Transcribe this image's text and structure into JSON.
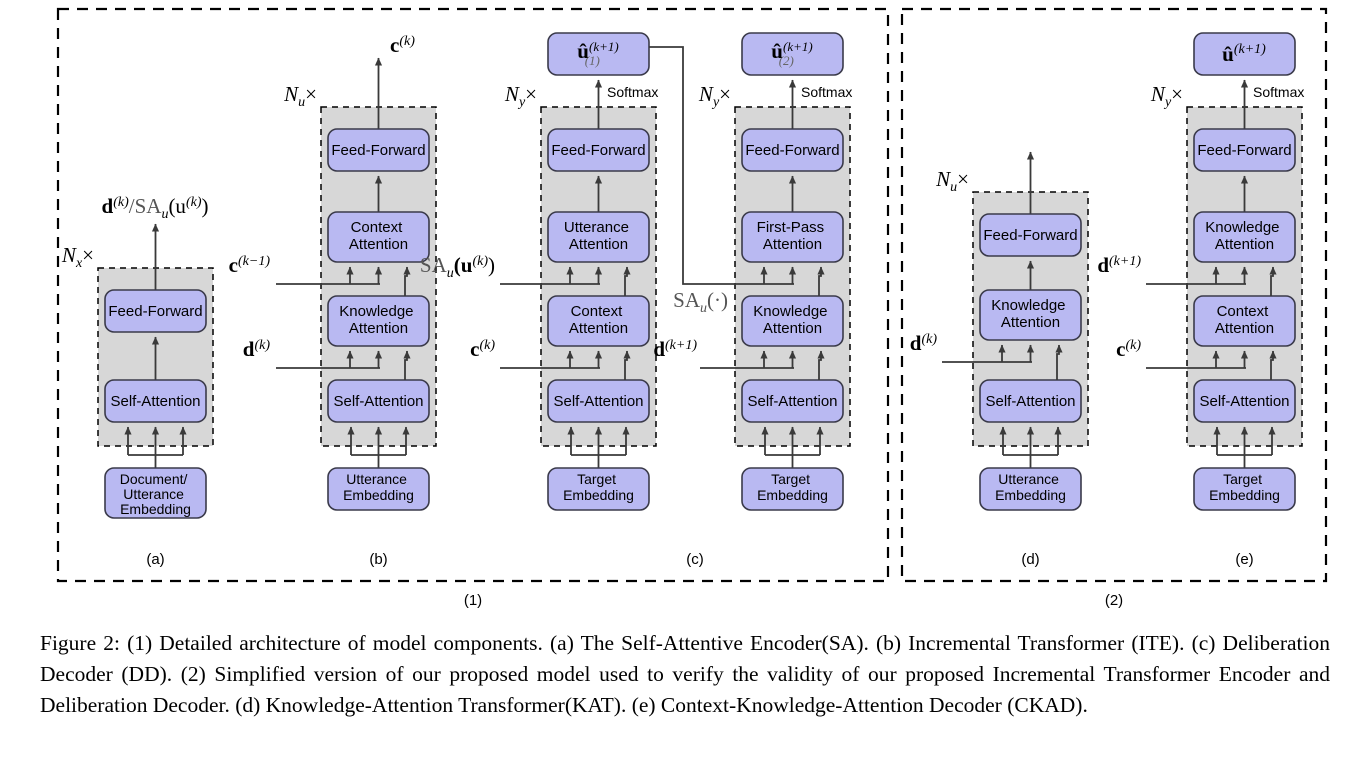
{
  "figure": {
    "caption": "Figure 2: (1) Detailed architecture of model components. (a) The Self-Attentive Encoder(SA). (b) Incremental Transformer (ITE). (c) Deliberation Decoder (DD). (2) Simplified version of our proposed model used to verify the validity of our proposed Incremental Transformer Encoder and Deliberation Decoder. (d) Knowledge-Attention Transformer(KAT). (e) Context-Knowledge-Attention Decoder (CKAD).",
    "group_labels": {
      "left": "(1)",
      "right": "(2)"
    },
    "panel_labels": {
      "a": "(a)",
      "b": "(b)",
      "c": "(c)",
      "d": "(d)",
      "e": "(e)"
    }
  },
  "colors": {
    "box_fill": "#b9b9f2",
    "box_stroke": "#3a3a4a",
    "panel_fill": "#d7d7d7",
    "line": "#3a3a3a",
    "background": "#ffffff"
  },
  "blocks": {
    "feed_forward": "Feed-Forward",
    "self_attention": "Self-Attention",
    "context_attention_l1": "Context",
    "context_attention_l2": "Attention",
    "knowledge_attention_l1": "Knowledge",
    "knowledge_attention_l2": "Attention",
    "utterance_attention_l1": "Utterance",
    "utterance_attention_l2": "Attention",
    "first_pass_attention_l1": "First-Pass",
    "first_pass_attention_l2": "Attention",
    "document_utterance_embedding_l1": "Document/",
    "document_utterance_embedding_l2": "Utterance",
    "document_utterance_embedding_l3": "Embedding",
    "utterance_embedding_l1": "Utterance",
    "utterance_embedding_l2": "Embedding",
    "target_embedding_l1": "Target",
    "target_embedding_l2": "Embedding",
    "softmax": "Softmax"
  },
  "panel_a": {
    "repeat": "N",
    "repeat_sub": "x",
    "repeat_times": "×",
    "output_label_main": "d",
    "output_label_sup": "(k)",
    "output_label_rest": "/SA",
    "output_label_rest_sub": "u",
    "output_label_tail": "(u",
    "output_label_tail_sup": "(k)",
    "output_label_tail_close": ")"
  },
  "panel_b": {
    "repeat": "N",
    "repeat_sub": "u",
    "repeat_times": "×",
    "output_main": "c",
    "output_sup": "(k)",
    "input_context_main": "c",
    "input_context_sup": "(k−1)",
    "input_doc_main": "d",
    "input_doc_sup": "(k)"
  },
  "panel_c_left": {
    "repeat": "N",
    "repeat_sub": "y",
    "repeat_times": "×",
    "output_main": "û",
    "output_sup": "(k+1)",
    "output_sub": "(1)",
    "input_sa_main": "SA",
    "input_sa_sub": "u",
    "input_sa_arg": "(u",
    "input_sa_arg_sup": "(k)",
    "input_sa_close": ")",
    "input_ctx_main": "c",
    "input_ctx_sup": "(k)"
  },
  "panel_c_right": {
    "repeat": "N",
    "repeat_sub": "y",
    "repeat_times": "×",
    "output_main": "û",
    "output_sup": "(k+1)",
    "output_sub": "(2)",
    "input_sa_main": "SA",
    "input_sa_sub": "u",
    "input_sa_arg": "(·)",
    "input_doc_main": "d",
    "input_doc_sup": "(k+1)"
  },
  "panel_d": {
    "repeat": "N",
    "repeat_sub": "u",
    "repeat_times": "×",
    "input_doc_main": "d",
    "input_doc_sup": "(k)"
  },
  "panel_e": {
    "repeat": "N",
    "repeat_sub": "y",
    "repeat_times": "×",
    "output_main": "û",
    "output_sup": "(k+1)",
    "input_doc_main": "d",
    "input_doc_sup": "(k+1)",
    "input_ctx_main": "c",
    "input_ctx_sup": "(k)"
  }
}
